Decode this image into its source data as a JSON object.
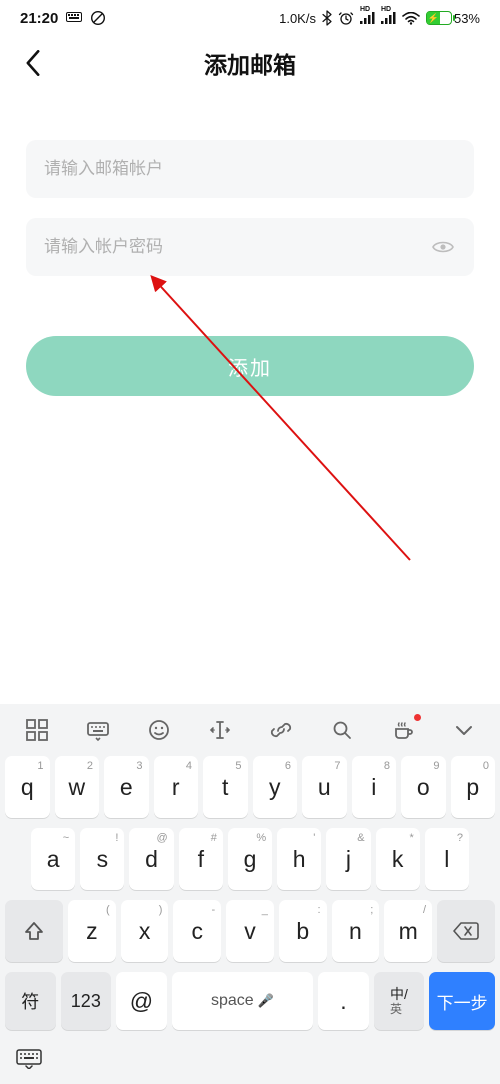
{
  "status": {
    "time": "21:20",
    "net_speed": "1.0K/s",
    "signal_label_1": "HD",
    "signal_label_2": "HD",
    "battery_pct": "53%"
  },
  "header": {
    "title": "添加邮箱"
  },
  "form": {
    "account_placeholder": "请输入邮箱帐户",
    "password_placeholder": "请输入帐户密码",
    "submit_label": "添加"
  },
  "keyboard": {
    "row1_sup": [
      "1",
      "2",
      "3",
      "4",
      "5",
      "6",
      "7",
      "8",
      "9",
      "0"
    ],
    "row1": [
      "q",
      "w",
      "e",
      "r",
      "t",
      "y",
      "u",
      "i",
      "o",
      "p"
    ],
    "row2_sup": [
      "~",
      "!",
      "@",
      "#",
      "%",
      "'",
      "&",
      "*",
      "?"
    ],
    "row2": [
      "a",
      "s",
      "d",
      "f",
      "g",
      "h",
      "j",
      "k",
      "l"
    ],
    "row3_sup": [
      "",
      "(",
      ")",
      "-",
      "_",
      ":",
      ";",
      "/"
    ],
    "row3": [
      "z",
      "x",
      "c",
      "v",
      "b",
      "n",
      "m"
    ],
    "row4": {
      "sym": "符",
      "num": "123",
      "at": "@",
      "space": "space",
      "dot": ".",
      "lang_top": "中/",
      "lang_bottom": "英",
      "action": "下一步"
    }
  }
}
